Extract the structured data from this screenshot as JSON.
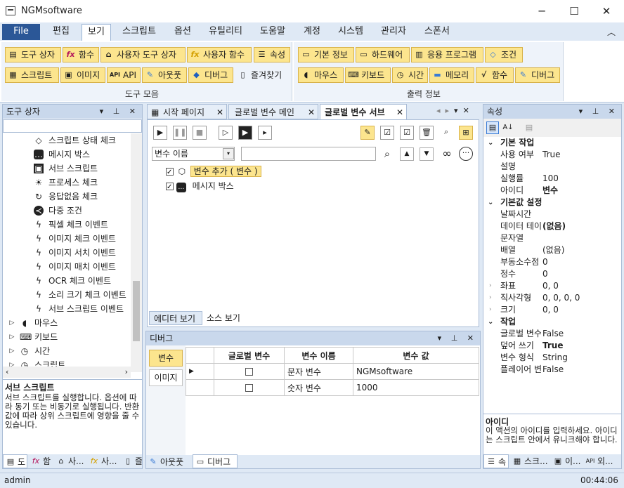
{
  "window": {
    "title": "NGMsoftware",
    "minimize": "─",
    "maximize": "☐",
    "close": "✕"
  },
  "menu": {
    "file": "File",
    "tabs": [
      "편집",
      "보기",
      "스크립트",
      "옵션",
      "유틸리티",
      "도움말",
      "계정",
      "시스템",
      "관리자",
      "스폰서"
    ],
    "active": "보기",
    "collapse": "︿"
  },
  "ribbon": {
    "group1": {
      "label": "도구 모음",
      "row1": [
        "도구 상자",
        "함수",
        "사용자 도구 상자",
        "사용자 함수",
        "속성"
      ],
      "row2": [
        "스크립트",
        "이미지",
        "API",
        "아웃풋",
        "디버그",
        "즐겨찾기"
      ]
    },
    "group2": {
      "label": "출력 정보",
      "row1": [
        "기본 정보",
        "하드웨어",
        "응용 프로그램",
        "조건"
      ],
      "row2": [
        "마우스",
        "키보드",
        "시간",
        "메모리",
        "함수",
        "디버그"
      ]
    }
  },
  "toolbox": {
    "title": "도구 상자",
    "search": "",
    "items": [
      "스크립트 상태 체크",
      "메시지 박스",
      "서브 스크립트",
      "프로세스 체크",
      "응답없음 체크",
      "다중 조건",
      "픽셀 체크 이벤트",
      "이미지 체크 이벤트",
      "이미지 서치 이벤트",
      "이미지 매치 이벤트",
      "OCR 체크 이벤트",
      "소리 크기 체크 이벤트",
      "서브 스크립트 이벤트"
    ],
    "groups": [
      "마우스",
      "키보드",
      "시간",
      "스크립트"
    ],
    "desc_title": "서브 스크립트",
    "desc": "서브 스크립트를 실행합니다. 옵션에 따라 동기 또는 비동기로 실행됩니다. 반환값에 따라 상위 스크립트에 영향을 줄 수 있습니다.",
    "bottom_tabs": [
      "도",
      "함",
      "사...",
      "사...",
      "즐"
    ]
  },
  "doc": {
    "tabs": [
      "시작 페이지",
      "글로벌 변수 메인",
      "글로벌 변수 서브"
    ],
    "active": "글로벌 변수 서브",
    "filter_select": "변수 이름",
    "filter_input": "",
    "tree": [
      {
        "label": "변수 추가 ( 변수 )",
        "checked": true
      },
      {
        "label": "메시지 박스",
        "checked": true
      }
    ],
    "view_tabs": [
      "에디터 보기",
      "소스 보기"
    ]
  },
  "debug": {
    "title": "디버그",
    "side_buttons": [
      "변수",
      "이미지"
    ],
    "columns": [
      "글로벌 변수",
      "변수 이름",
      "변수 값"
    ],
    "rows": [
      {
        "global": false,
        "name": "문자 변수",
        "value": "NGMsoftware"
      },
      {
        "global": false,
        "name": "숫자 변수",
        "value": "1000"
      }
    ],
    "bottom_tabs": [
      "아웃풋",
      "디버그"
    ]
  },
  "props": {
    "title": "속성",
    "cat1": "기본 작업",
    "cat1_rows": [
      [
        "사용 여부",
        "True"
      ],
      [
        "설명",
        ""
      ],
      [
        "실행률",
        "100"
      ],
      [
        "아이디",
        "변수"
      ]
    ],
    "cat2": "기본값 설정",
    "cat2_rows": [
      [
        "날짜시간",
        ""
      ],
      [
        "데이터 테이",
        "(없음)"
      ],
      [
        "문자열",
        ""
      ],
      [
        "배열",
        "(없음)"
      ],
      [
        "부동소수점",
        "0"
      ],
      [
        "정수",
        "0"
      ],
      [
        "좌표",
        "0, 0"
      ],
      [
        "직사각형",
        "0, 0, 0, 0"
      ],
      [
        "크기",
        "0, 0"
      ]
    ],
    "cat3": "작업",
    "cat3_rows": [
      [
        "글로벌 변수",
        "False"
      ],
      [
        "덮어 쓰기",
        "True"
      ],
      [
        "변수 형식",
        "String"
      ],
      [
        "플레이어 변수",
        "False"
      ]
    ],
    "desc_title": "아이디",
    "desc": "이 액션의 아이디를 입력하세요. 아이디는 스크립트 안에서 유니크해야 합니다.",
    "bottom_tabs": [
      "속",
      "스크...",
      "이...",
      "외..."
    ]
  },
  "status": {
    "user": "admin",
    "time": "00:44:06"
  }
}
